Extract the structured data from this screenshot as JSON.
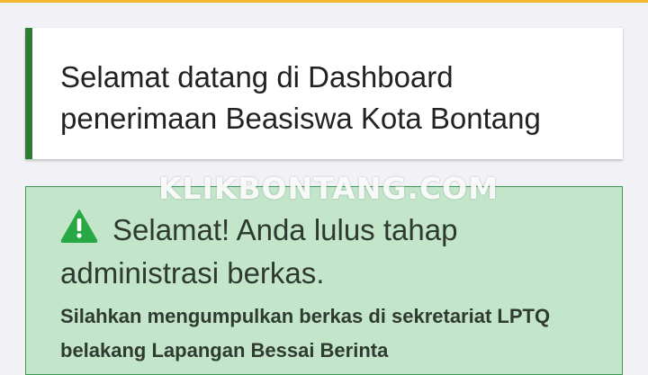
{
  "colors": {
    "top_bar": "#f5b731",
    "card_accent": "#2e7d32",
    "alert_background": "#c3e6cb",
    "alert_border": "#3e9a55",
    "icon": "#28a745"
  },
  "welcome": {
    "title": "Selamat datang di Dashboard penerimaan Beasiswa Kota Bontang"
  },
  "watermark": {
    "text": "KLIKBONTANG.COM"
  },
  "alert": {
    "icon": "warning-triangle-icon",
    "heading": "Selamat! Anda lulus tahap administrasi berkas.",
    "body": "Silahkan mengumpulkan berkas di sekretariat LPTQ belakang Lapangan Bessai Berinta"
  }
}
